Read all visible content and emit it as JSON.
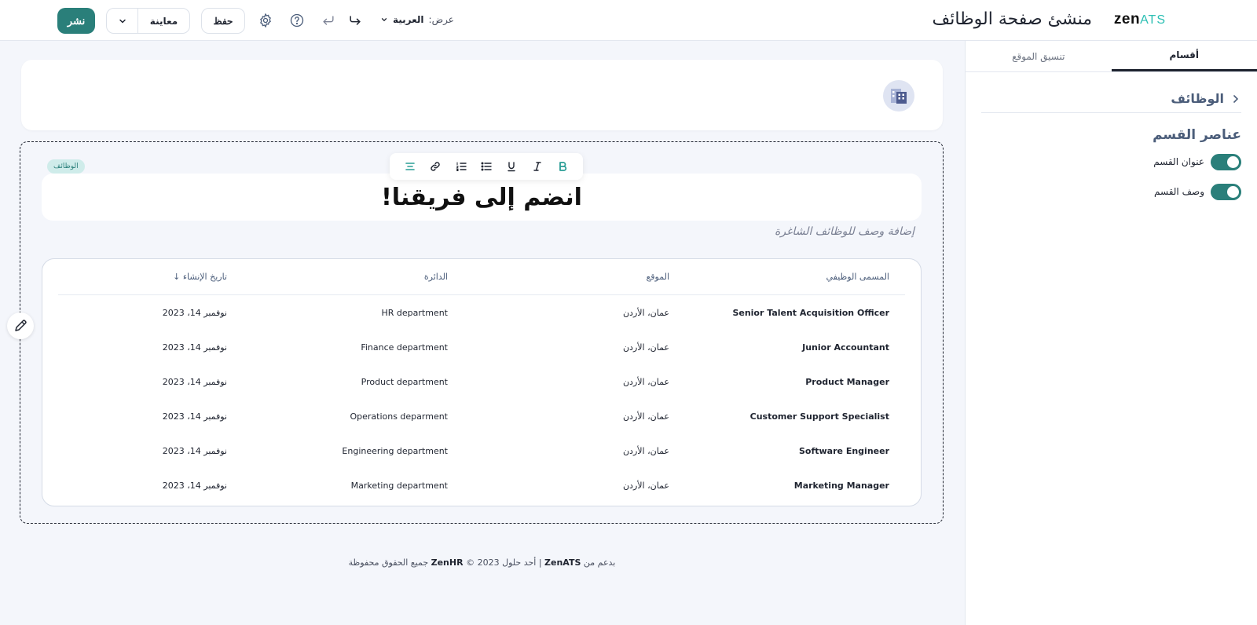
{
  "header": {
    "brand_main": "zen",
    "brand_accent": "ATS",
    "app_title": "منشئ صفحة الوظائف",
    "view_label": "عرض:",
    "view_value": "العربية",
    "save_label": "حفظ",
    "preview_label": "معاينة",
    "publish_label": "نشر"
  },
  "panel": {
    "tabs": [
      {
        "label": "أقسام",
        "active": true
      },
      {
        "label": "تنسيق الموقع",
        "active": false
      }
    ],
    "section_name": "الوظائف",
    "elements_title": "عناصر القسم",
    "toggles": [
      {
        "label": "عنوان القسم",
        "on": true
      },
      {
        "label": "وصف القسم",
        "on": true
      }
    ]
  },
  "jobs": {
    "badge": "الوظائف",
    "heading": "انضم إلى فريقنا!",
    "description_placeholder": "إضافة وصف للوظائف الشاغرة",
    "columns": {
      "title": "المسمى الوظيفي",
      "location": "الموقع",
      "department": "الدائرة",
      "date": "تاريخ الإنشاء ↓"
    },
    "rows": [
      {
        "title": "Senior Talent Acquisition Officer",
        "location": "عمان، الأردن",
        "department": "HR department",
        "date": "نوفمبر 14، 2023"
      },
      {
        "title": "Junior Accountant",
        "location": "عمان، الأردن",
        "department": "Finance department",
        "date": "نوفمبر 14، 2023"
      },
      {
        "title": "Product Manager",
        "location": "عمان، الأردن",
        "department": "Product department",
        "date": "نوفمبر 14، 2023"
      },
      {
        "title": "Customer Support Specialist",
        "location": "عمان، الأردن",
        "department": "Operations deparment",
        "date": "نوفمبر 14، 2023"
      },
      {
        "title": "Software Engineer",
        "location": "عمان، الأردن",
        "department": "Engineering department",
        "date": "نوفمبر 14، 2023"
      },
      {
        "title": "Marketing Manager",
        "location": "عمان، الأردن",
        "department": "Marketing department",
        "date": "نوفمبر 14، 2023"
      }
    ]
  },
  "footer": {
    "prefix": "بدعم من",
    "brand": "ZenATS",
    "middle": "| أحد حلول",
    "company": "ZenHR",
    "suffix": "© 2023 جميع الحقوق محفوظة"
  },
  "colors": {
    "primary": "#2a7f7a",
    "accent": "#2bbfb3",
    "panel_heading": "#4b5d7a"
  }
}
